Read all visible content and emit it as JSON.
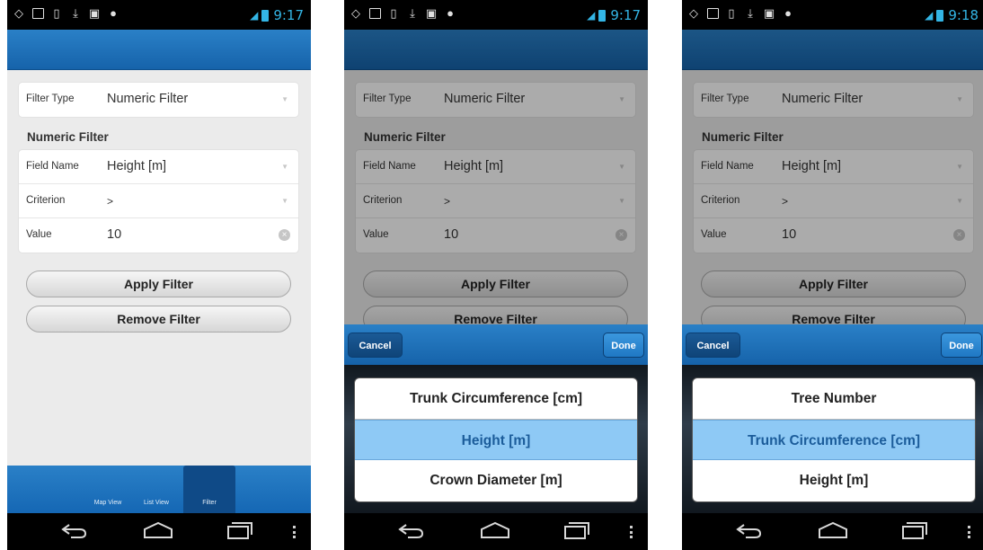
{
  "screens": [
    {
      "status": {
        "time": "9:17"
      },
      "filter_type": {
        "label": "Filter Type",
        "value": "Numeric Filter"
      },
      "section_title": "Numeric Filter",
      "field_name": {
        "label": "Field Name",
        "value": "Height [m]"
      },
      "criterion": {
        "label": "Criterion",
        "value": ">"
      },
      "value_field": {
        "label": "Value",
        "value": "10"
      },
      "apply_label": "Apply Filter",
      "remove_label": "Remove Filter",
      "tabs": [
        {
          "label": "Map View",
          "active": false
        },
        {
          "label": "List View",
          "active": false
        },
        {
          "label": "Filter",
          "active": true
        }
      ]
    },
    {
      "status": {
        "time": "9:17"
      },
      "filter_type": {
        "label": "Filter Type",
        "value": "Numeric Filter"
      },
      "section_title": "Numeric Filter",
      "field_name": {
        "label": "Field Name",
        "value": "Height [m]"
      },
      "criterion": {
        "label": "Criterion",
        "value": ">"
      },
      "value_field": {
        "label": "Value",
        "value": "10"
      },
      "apply_label": "Apply Filter",
      "remove_label": "Remove Filter",
      "picker": {
        "cancel_label": "Cancel",
        "done_label": "Done",
        "options": [
          "Trunk Circumference [cm]",
          "Height [m]",
          "Crown Diameter [m]"
        ],
        "selected_index": 1
      }
    },
    {
      "status": {
        "time": "9:18"
      },
      "filter_type": {
        "label": "Filter Type",
        "value": "Numeric Filter"
      },
      "section_title": "Numeric Filter",
      "field_name": {
        "label": "Field Name",
        "value": "Height [m]"
      },
      "criterion": {
        "label": "Criterion",
        "value": ">"
      },
      "value_field": {
        "label": "Value",
        "value": "10"
      },
      "apply_label": "Apply Filter",
      "remove_label": "Remove Filter",
      "picker": {
        "cancel_label": "Cancel",
        "done_label": "Done",
        "options": [
          "Tree Number",
          "Trunk Circumference [cm]",
          "Height [m]"
        ],
        "selected_index": 1
      }
    }
  ],
  "colors": {
    "accent_blue": "#1f6db5",
    "selected_row": "#8ec9f5",
    "status_text": "#33b5e5"
  },
  "icons": {
    "status_bar": [
      "location-icon",
      "image-icon",
      "sim-icon",
      "download-icon",
      "media-icon",
      "gamepad-icon",
      "signal-icon",
      "battery-icon"
    ],
    "nav": [
      "back-icon",
      "home-icon",
      "recent-apps-icon",
      "menu-icon"
    ]
  }
}
